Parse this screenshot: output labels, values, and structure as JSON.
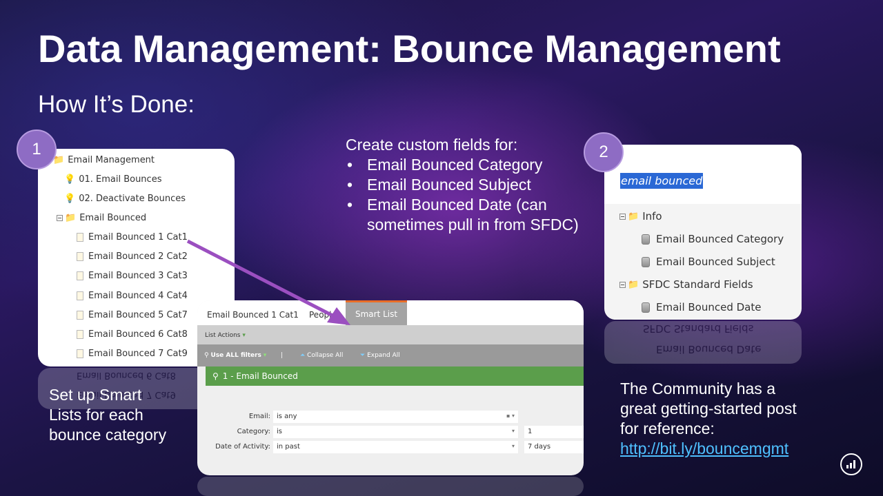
{
  "slide": {
    "title": "Data Management: Bounce Management",
    "subtitle": "How It’s Done:"
  },
  "steps": [
    "1",
    "2"
  ],
  "tree": {
    "root": "Email Management",
    "items": [
      {
        "label": "01. Email Bounces",
        "icon": "lightbulb-icon"
      },
      {
        "label": "02. Deactivate Bounces",
        "icon": "lightbulb-icon"
      }
    ],
    "folder": "Email Bounced",
    "lists": [
      "Email Bounced 1 Cat1",
      "Email Bounced 2 Cat2",
      "Email Bounced 3 Cat3",
      "Email Bounced 4 Cat4",
      "Email Bounced 5 Cat7",
      "Email Bounced 6 Cat8",
      "Email Bounced 7 Cat9"
    ]
  },
  "captions": {
    "left": [
      "Set up Smart",
      "Lists for each",
      "bounce category"
    ],
    "right": [
      "The Community has a",
      "great getting-started post",
      "for reference:"
    ],
    "link": "http://bit.ly/bouncemgmt"
  },
  "custom_fields": {
    "intro": "Create custom fields for:",
    "bullets": [
      "Email Bounced Category",
      "Email Bounced Subject",
      "Email Bounced Date (can sometimes pull in from SFDC)"
    ]
  },
  "smart_list": {
    "tabs": [
      "Email Bounced 1 Cat1",
      "People",
      "Smart List"
    ],
    "list_actions": "List Actions",
    "use_all": "Use ALL filters",
    "separator": "|",
    "collapse_all": "Collapse All",
    "expand_all": "Expand All",
    "filter_title": "1 - Email Bounced",
    "filters": [
      {
        "label": "Email:",
        "value": "is any",
        "extra": ""
      },
      {
        "label": "Category:",
        "value": "is",
        "extra": "1"
      },
      {
        "label": "Date of Activity:",
        "value": "in past",
        "extra": "7 days"
      }
    ]
  },
  "field_search": {
    "query": "email bounced",
    "groups": [
      {
        "name": "Info",
        "fields": [
          "Email Bounced Category",
          "Email Bounced Subject"
        ]
      },
      {
        "name": "SFDC Standard Fields",
        "fields": [
          "Email Bounced Date"
        ]
      }
    ]
  },
  "colors": {
    "step_circle": "#8e6cc4",
    "arrow": "#9b4fc0",
    "filter_header": "#5b9e4b",
    "active_tab_border": "#e96d27",
    "search_highlight": "#2a68d5",
    "link": "#4fc0ff"
  }
}
